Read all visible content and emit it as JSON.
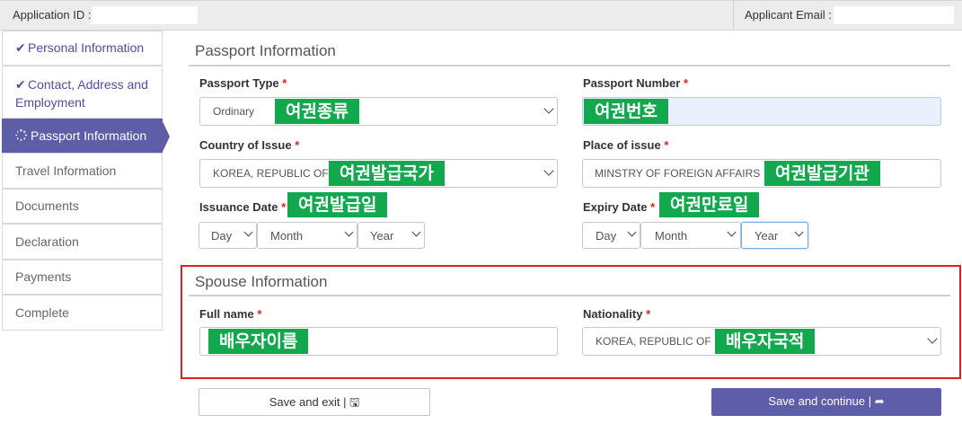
{
  "header": {
    "application_id_label": "Application ID :",
    "applicant_email_label": "Applicant Email :"
  },
  "sidebar": {
    "items": [
      {
        "label": "Personal Information",
        "status": "done"
      },
      {
        "label": "Contact, Address and Employment",
        "status": "done"
      },
      {
        "label": "Passport Information",
        "status": "active"
      },
      {
        "label": "Travel Information",
        "status": "pending"
      },
      {
        "label": "Documents",
        "status": "pending"
      },
      {
        "label": "Declaration",
        "status": "pending"
      },
      {
        "label": "Payments",
        "status": "pending"
      },
      {
        "label": "Complete",
        "status": "pending"
      }
    ],
    "contact_line1": "Contact, Address and",
    "contact_line2": "Employment"
  },
  "passport": {
    "title": "Passport Information",
    "type_label": "Passport Type",
    "type_value": "Ordinary",
    "type_tag": "여권종류",
    "number_label": "Passport Number",
    "number_tag": "여권번호",
    "country_label": "Country of Issue",
    "country_value": "KOREA, REPUBLIC OF",
    "country_tag": "여권발급국가",
    "place_label": "Place of issue",
    "place_value": "MINSTRY OF FOREIGN AFFAIRS",
    "place_tag": "여권발급기관",
    "issuance_label": "Issuance Date",
    "issuance_tag": "여권발급일",
    "expiry_label": "Expiry Date",
    "expiry_tag": "여권만료일",
    "day_placeholder": "Day",
    "month_placeholder": "Month",
    "year_placeholder": "Year",
    "required_mark": "*"
  },
  "spouse": {
    "title": "Spouse Information",
    "fullname_label": "Full name",
    "fullname_tag": "배우자이름",
    "nationality_label": "Nationality",
    "nationality_value": "KOREA, REPUBLIC OF",
    "nationality_tag": "배우자국적"
  },
  "actions": {
    "save_exit": "Save and exit | 🖫",
    "save_continue": "Save and continue | ➦"
  },
  "colors": {
    "accent": "#5e5ea8",
    "tag_green": "#12a94e",
    "highlight_red": "#e02020",
    "focused_input": "#e8f0fc"
  }
}
